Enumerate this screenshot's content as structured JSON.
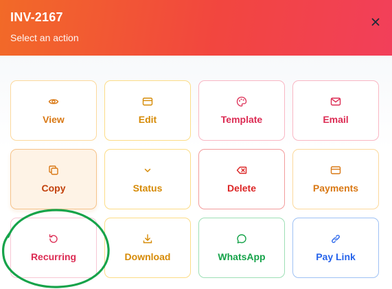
{
  "header": {
    "title": "INV-2167",
    "subtitle": "Select an action",
    "close_icon": "close-icon"
  },
  "actions": [
    {
      "label": "View",
      "icon": "eye-icon",
      "color": "#d97814"
    },
    {
      "label": "Edit",
      "icon": "card-icon",
      "color": "#d68a05"
    },
    {
      "label": "Template",
      "icon": "palette-icon",
      "color": "#dc2b53"
    },
    {
      "label": "Email",
      "icon": "mail-icon",
      "color": "#dc2b53"
    },
    {
      "label": "Copy",
      "icon": "copy-icon",
      "color": "#c2410c",
      "highlighted": true
    },
    {
      "label": "Status",
      "icon": "chevron-down-icon",
      "color": "#d68a05"
    },
    {
      "label": "Delete",
      "icon": "backspace-icon",
      "color": "#dc2626"
    },
    {
      "label": "Payments",
      "icon": "card-icon",
      "color": "#d97814"
    },
    {
      "label": "Recurring",
      "icon": "refresh-icon",
      "color": "#dc2b53",
      "circled": true
    },
    {
      "label": "Download",
      "icon": "download-icon",
      "color": "#d68a05"
    },
    {
      "label": "WhatsApp",
      "icon": "chat-icon",
      "color": "#16a34a"
    },
    {
      "label": "Pay Link",
      "icon": "link-icon",
      "color": "#2563eb"
    }
  ],
  "colors": {
    "header_gradient_start": "#f26a28",
    "header_gradient_end": "#f23f5a",
    "annotation_circle": "#16a34a"
  }
}
